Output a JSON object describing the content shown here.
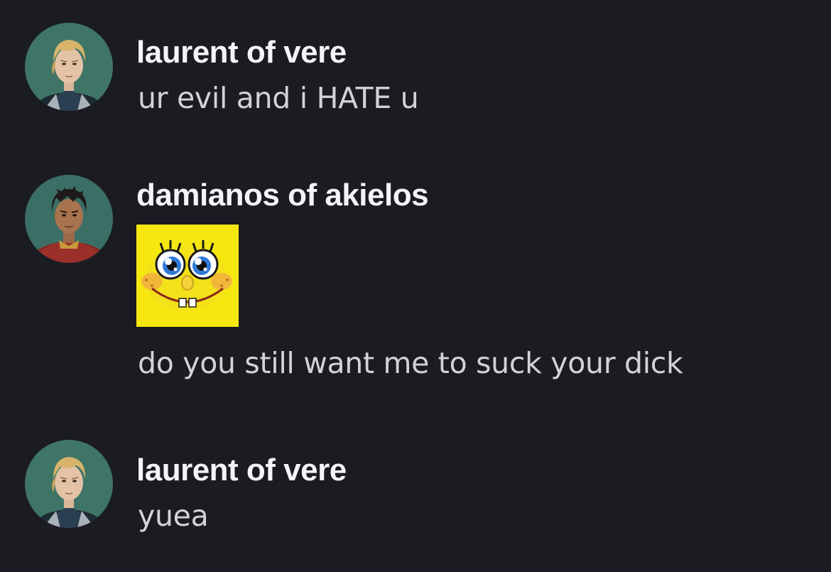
{
  "messages": [
    {
      "author": "laurent of vere",
      "avatar_icon": "laurent-avatar",
      "text": "ur evil and i HATE u"
    },
    {
      "author": "damianos of akielos",
      "avatar_icon": "damianos-avatar",
      "sticker_icon": "spongebob-pleading-face-sticker",
      "text": "do you still want me to suck your dick"
    },
    {
      "author": "laurent of vere",
      "avatar_icon": "laurent-avatar",
      "text": "yuea"
    }
  ],
  "colors": {
    "background": "#1b1b22",
    "username": "#f4f4f6",
    "message_text": "#d2d3d8",
    "sticker_yellow": "#f7e711"
  }
}
